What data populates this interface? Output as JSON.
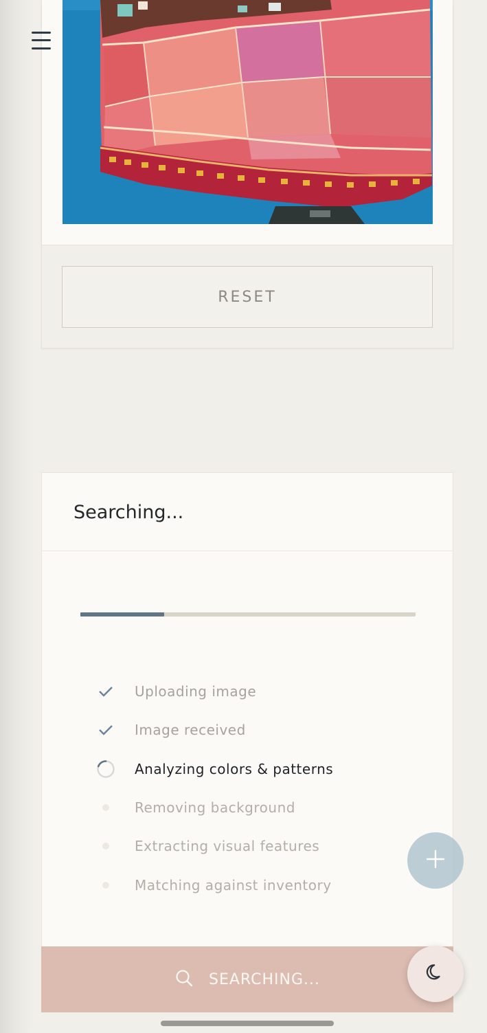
{
  "upload": {
    "reset_label": "RESET"
  },
  "search_panel": {
    "title": "Searching...",
    "progress_fraction": 0.25,
    "steps": [
      {
        "label": "Uploading image",
        "status": "done"
      },
      {
        "label": "Image received",
        "status": "done"
      },
      {
        "label": "Analyzing colors & patterns",
        "status": "active"
      },
      {
        "label": "Removing background",
        "status": "pending"
      },
      {
        "label": "Extracting visual features",
        "status": "pending"
      },
      {
        "label": "Matching against inventory",
        "status": "pending"
      }
    ]
  },
  "search_button": {
    "label": "SEARCHING...",
    "icon": "search-icon"
  },
  "fabs": {
    "add_icon": "plus-icon",
    "theme_icon": "moon-icon"
  },
  "colors": {
    "background": "#f1efea",
    "card": "#fcfaf6",
    "progress_fill": "#5f7588",
    "progress_track": "#d8d5c8",
    "search_button": "#dcbcb1",
    "fab_add": "#b0c4d0"
  }
}
